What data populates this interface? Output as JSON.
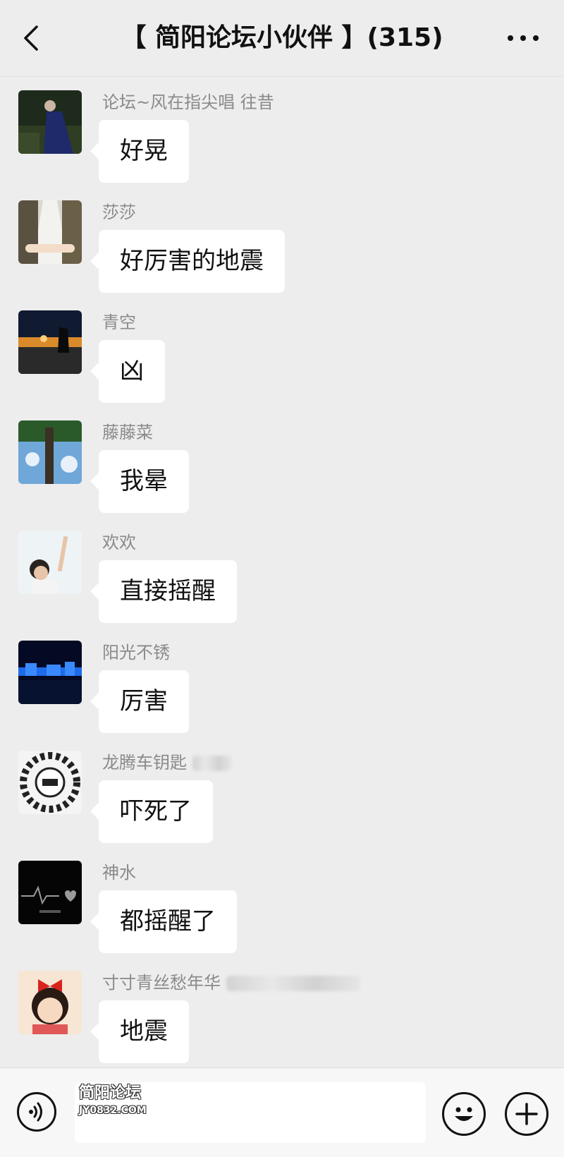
{
  "header": {
    "title": "【 简阳论坛小伙伴 】(315)",
    "back_icon": "chevron-left-icon",
    "more_icon": "more-dots-icon"
  },
  "messages": [
    {
      "sender": "论坛~风在指尖唱  往昔",
      "text": "好晃",
      "avatar": "avatar-night-woman"
    },
    {
      "sender": "莎莎",
      "text": "好厉害的地震",
      "avatar": "avatar-holding-hands-stairs"
    },
    {
      "sender": "青空",
      "text": "凶",
      "avatar": "avatar-sunset-silhouette"
    },
    {
      "sender": "藤藤菜",
      "text": "我晕",
      "avatar": "avatar-tree-sky"
    },
    {
      "sender": "欢欢",
      "text": "直接摇醒",
      "avatar": "avatar-child-reaching"
    },
    {
      "sender": "阳光不锈",
      "text": "厉害",
      "avatar": "avatar-night-city"
    },
    {
      "sender": "龙腾车钥匙",
      "text": "吓死了",
      "avatar": "avatar-car-keys-logo"
    },
    {
      "sender": "神水",
      "text": "都摇醒了",
      "avatar": "avatar-black-heartbeat"
    },
    {
      "sender": "寸寸青丝愁年华",
      "text": "地震",
      "avatar": "avatar-cartoon-girl-bow"
    }
  ],
  "footer": {
    "voice_icon": "voice-icon",
    "emoji_icon": "emoji-icon",
    "plus_icon": "plus-icon",
    "watermark_title": "简阳论坛",
    "watermark_sub": "JY0832.COM"
  },
  "colors": {
    "background": "#ededed",
    "bubble": "#ffffff",
    "sender_text": "#8a8a8a",
    "footer": "#f7f7f7"
  }
}
